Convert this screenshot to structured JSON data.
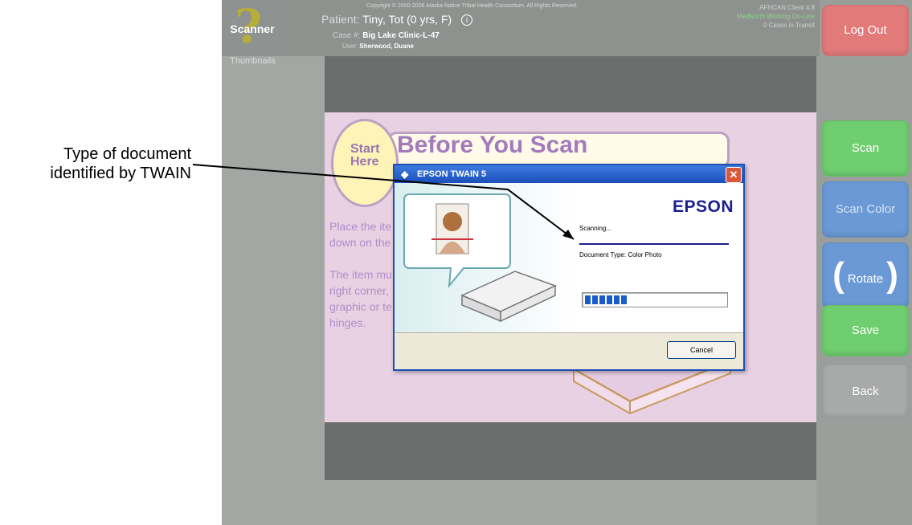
{
  "annotation": {
    "line1": "Type of document",
    "line2": "identified by TWAIN"
  },
  "header": {
    "app_name": "Scanner",
    "thumbnails_label": "Thumbnails",
    "copyright": "Copyright © 2000-2006 Alaska Native Tribal Health Consortium. All Rights Reserved.",
    "patient_key": "Patient:",
    "patient_value": "Tiny, Tot (0 yrs, F)",
    "case_key": "Case #:",
    "case_value": "Big Lake Clinic-L-47",
    "user_key": "User:",
    "user_value": "Sherwood, Duane",
    "client_version": "AFHCAN Client 4.8",
    "connection_status": "MedNorth Working On-Line",
    "transit_status": "0 Cases in Transit"
  },
  "instructions": {
    "start_label_line1": "Start",
    "start_label_line2": "Here",
    "title": "Before You Scan",
    "text": "Place the ite\ndown on the\n\nThe item mu\nright corner,\ngraphic or te\nhinges."
  },
  "buttons": {
    "logout": "Log Out",
    "scan": "Scan",
    "scan_color": "Scan Color",
    "rotate": "Rotate",
    "save": "Save",
    "back": "Back"
  },
  "dialog": {
    "title": "EPSON TWAIN 5",
    "brand": "EPSON",
    "status": "Scanning...",
    "doc_type": "Document Type:  Color Photo",
    "progress_fraction": 0.33,
    "cancel_label": "Cancel"
  },
  "colors": {
    "logout": "#e27a7a",
    "scan": "#6fce6f",
    "scan_color": "#6b99d6",
    "back": "#a7aaa8",
    "epson_blue": "#1c1f8c",
    "progress_blue": "#1c5cc8"
  }
}
